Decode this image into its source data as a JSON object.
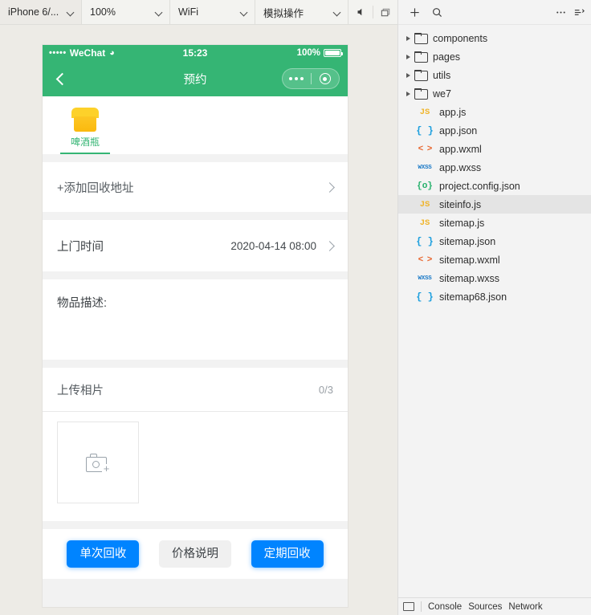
{
  "simulator_toolbar": {
    "device": "iPhone 6/...",
    "zoom": "100%",
    "network": "WiFi",
    "simulate": "模拟操作",
    "volume_icon": "speaker-icon",
    "window_icon": "window-layers-icon"
  },
  "phone": {
    "status_bar": {
      "signal_dots": "•••••",
      "carrier": "WeChat",
      "wifi_icon": "wifi-icon",
      "time": "15:23",
      "battery_percent": "100%"
    },
    "nav_bar": {
      "back_icon": "chevron-left-icon",
      "title": "预约",
      "more_icon": "more-dots-icon",
      "target_icon": "target-circle-icon"
    },
    "category_tabs": [
      {
        "label": "啤酒瓶",
        "icon": "shop-bin-icon",
        "active": true
      }
    ],
    "address_row": {
      "label": "+添加回收地址",
      "chevron_icon": "chevron-right-icon"
    },
    "time_row": {
      "label": "上门时间",
      "value": "2020-04-14 08:00",
      "chevron_icon": "chevron-right-icon"
    },
    "description": {
      "title": "物品描述:",
      "value": "",
      "placeholder": ""
    },
    "upload": {
      "title": "上传相片",
      "count": "0/3",
      "add_icon": "camera-plus-icon"
    },
    "buttons": {
      "single": "单次回收",
      "price": "价格说明",
      "periodic": "定期回收"
    },
    "colors": {
      "header_green": "#35b574",
      "primary_blue": "#0084ff",
      "accent_yellow": "#fdd12a"
    }
  },
  "explorer": {
    "toolbar": {
      "add_icon": "plus-icon",
      "search_icon": "search-icon",
      "more_icon": "more-dots-icon",
      "collapse_icon": "collapse-all-icon"
    },
    "tree": [
      {
        "type": "folder",
        "label": "components",
        "expanded": false
      },
      {
        "type": "folder",
        "label": "pages",
        "expanded": false
      },
      {
        "type": "folder",
        "label": "utils",
        "expanded": false
      },
      {
        "type": "folder",
        "label": "we7",
        "expanded": false
      },
      {
        "type": "file",
        "label": "app.js",
        "kind": "js",
        "glyph": "JS",
        "selected": false
      },
      {
        "type": "file",
        "label": "app.json",
        "kind": "json",
        "glyph": "{ }",
        "selected": false
      },
      {
        "type": "file",
        "label": "app.wxml",
        "kind": "wxml",
        "glyph": "< >",
        "selected": false
      },
      {
        "type": "file",
        "label": "app.wxss",
        "kind": "wxss",
        "glyph": "WXSS",
        "selected": false
      },
      {
        "type": "file",
        "label": "project.config.json",
        "kind": "cfg",
        "glyph": "{o}",
        "selected": false
      },
      {
        "type": "file",
        "label": "siteinfo.js",
        "kind": "js",
        "glyph": "JS",
        "selected": true
      },
      {
        "type": "file",
        "label": "sitemap.js",
        "kind": "js",
        "glyph": "JS",
        "selected": false
      },
      {
        "type": "file",
        "label": "sitemap.json",
        "kind": "json",
        "glyph": "{ }",
        "selected": false
      },
      {
        "type": "file",
        "label": "sitemap.wxml",
        "kind": "wxml",
        "glyph": "< >",
        "selected": false
      },
      {
        "type": "file",
        "label": "sitemap.wxss",
        "kind": "wxss",
        "glyph": "WXSS",
        "selected": false
      },
      {
        "type": "file",
        "label": "sitemap68.json",
        "kind": "json",
        "glyph": "{ }",
        "selected": false
      }
    ],
    "devtools_bar": {
      "panel_icon": "panel-icon",
      "tabs": [
        "Console",
        "Sources",
        "Network"
      ]
    }
  }
}
